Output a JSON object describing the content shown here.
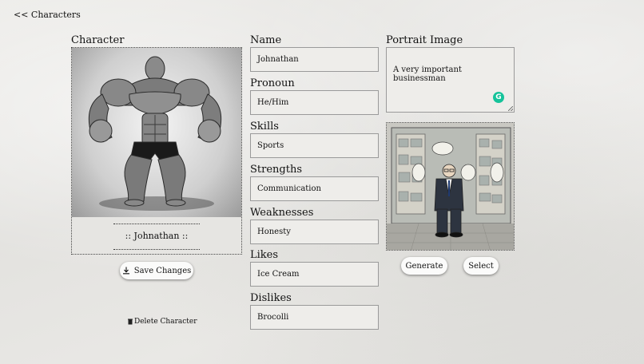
{
  "nav": {
    "back_label": "<< Characters"
  },
  "character": {
    "section_label": "Character",
    "name_display": ":: Johnathan ::",
    "save_label": "Save Changes",
    "delete_label": "Delete Character"
  },
  "fields": [
    {
      "label": "Name",
      "value": "Johnathan"
    },
    {
      "label": "Pronoun",
      "value": "He/Him"
    },
    {
      "label": "Skills",
      "value": "Sports"
    },
    {
      "label": "Strengths",
      "value": "Communication"
    },
    {
      "label": "Weaknesses",
      "value": "Honesty"
    },
    {
      "label": "Likes",
      "value": "Ice Cream"
    },
    {
      "label": "Dislikes",
      "value": "Brocolli"
    }
  ],
  "portrait": {
    "section_label": "Portrait Image",
    "prompt_value": "A very important businessman",
    "generate_label": "Generate",
    "select_label": "Select"
  },
  "colors": {
    "background": "#e7e6e3",
    "input_bg": "#eeedea",
    "input_border": "#9a9a9a",
    "button_bg": "#fbfbfa",
    "grammarly": "#15c39a"
  }
}
